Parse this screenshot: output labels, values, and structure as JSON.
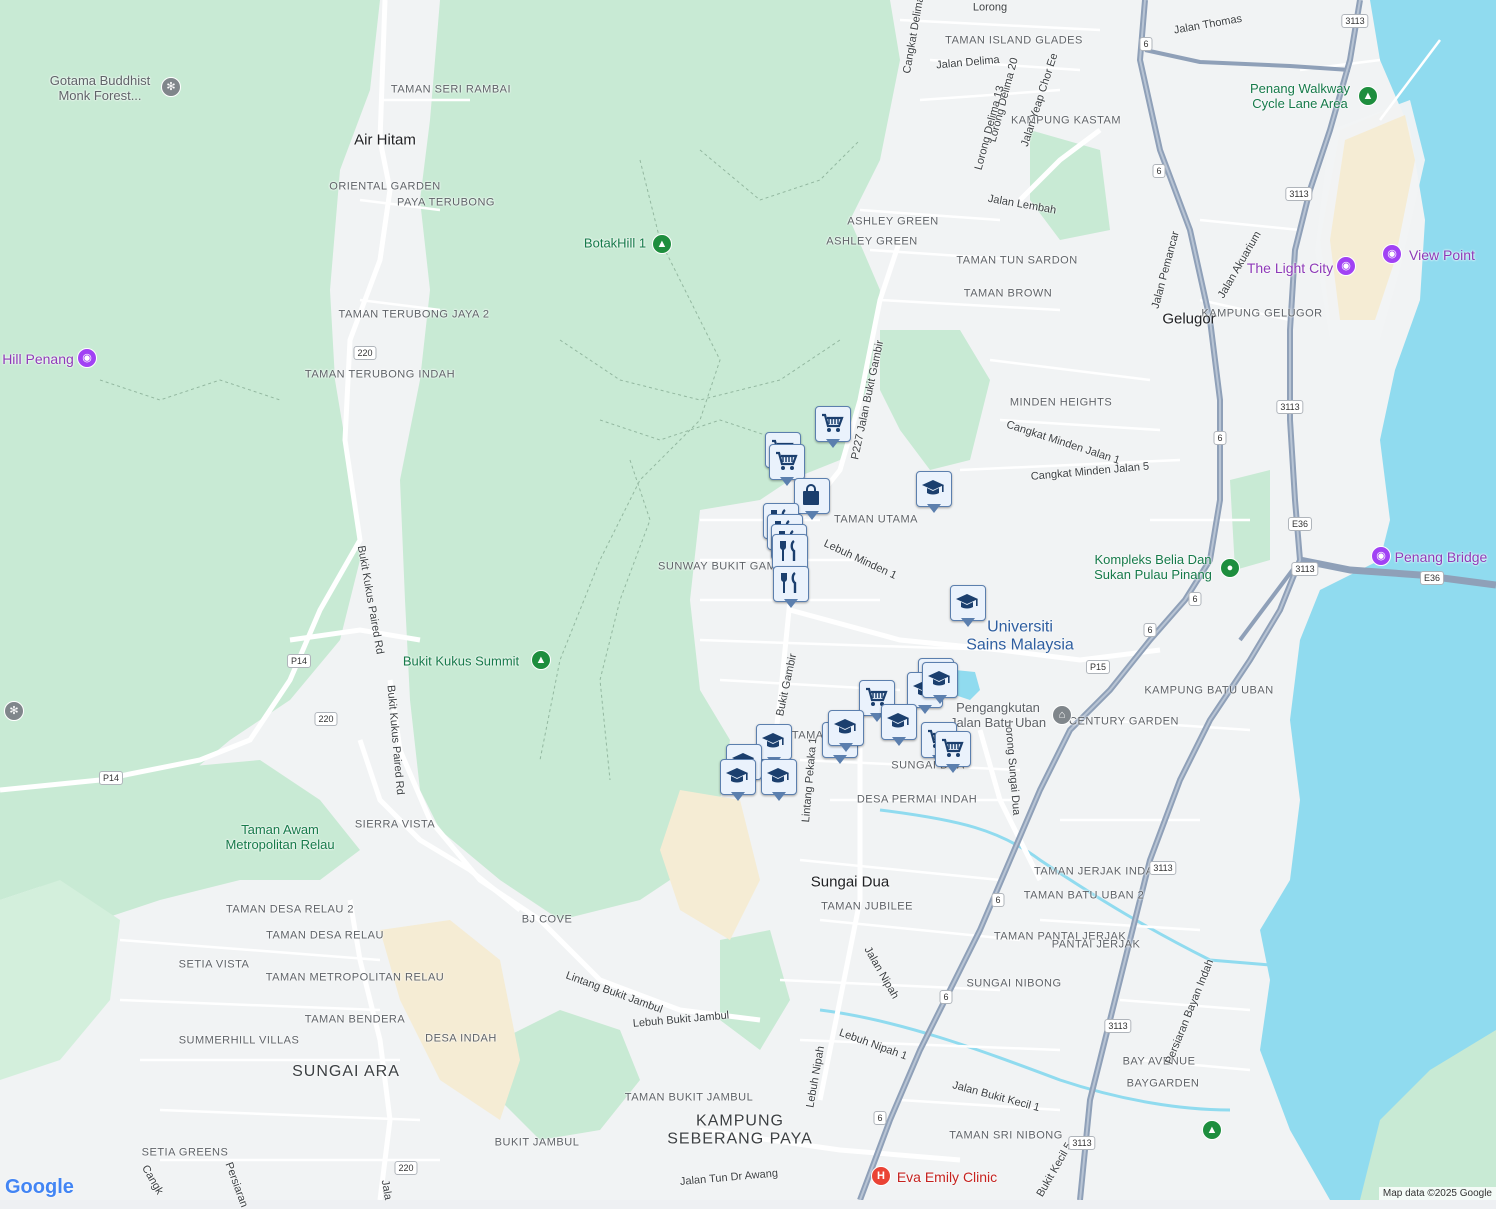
{
  "colors": {
    "forest": "#c8ead4",
    "urban": "#f1f3f4",
    "water": "#90dbef",
    "sand": "#f5ecd4",
    "highway": "#8fa0b8",
    "marker_fill": "#eaf2fc",
    "marker_border": "#5b7fae",
    "marker_icon": "#1b3f6e"
  },
  "labels": {
    "areas": [
      "TAMAN SERI RAMBAI",
      "ORIENTAL GARDEN",
      "PAYA TERUBONG",
      "TAMAN TERUBONG JAYA 2",
      "TAMAN TERUBONG INDAH",
      "SIERRA VISTA",
      "TAMAN DESA RELAU 2",
      "TAMAN DESA RELAU",
      "SETIA VISTA",
      "TAMAN METROPOLITAN RELAU",
      "TAMAN BENDERA",
      "SUMMERHILL VILLAS",
      "DESA INDAH",
      "SETIA GREENS",
      "BJ COVE",
      "TAMAN BUKIT JAMBUL",
      "BUKIT JAMBUL",
      "TAMAN ISLAND GLADES",
      "KAMPUNG KASTAM",
      "ASHLEY GREEN",
      "ASHLEY GREEN",
      "TAMAN TUN SARDON",
      "TAMAN BROWN",
      "KAMPUNG GELUGOR",
      "MINDEN HEIGHTS",
      "TAMAN UTAMA",
      "SUNWAY BUKIT GAMBIER",
      "CENTURY GARDEN",
      "KAMPUNG BATU UBAN",
      "TAMAN",
      "SUNGAI DUA",
      "DESA PERMAI INDAH",
      "TAMAN JUBILEE",
      "TAMAN JERJAK INDAH",
      "TAMAN BATU UBAN 2",
      "TAMAN PANTAI JERJAK",
      "PANTAI JERJAK",
      "SUNGAI NIBONG",
      "BAY AVENUE",
      "BAYGARDEN",
      "TAMAN SRI NIBONG"
    ],
    "places": [
      "Air Hitam",
      "Gelugor",
      "Sungai Dua"
    ],
    "places_large": [
      "SUNGAI ARA",
      "KAMPUNG SEBERANG PAYA"
    ],
    "university": "Universiti Sains Malaysia",
    "roads": [
      "Jalan Thomas",
      "Cangkat Delima",
      "Jalan Delima",
      "Lorong Delima 20",
      "Lorong Delima 13",
      "Jalan Yeap Chor Ee",
      "Jalan Lembah",
      "Jalan Pemancar",
      "Jalan Akuarium",
      "P227 Jalan Bukit Gambir",
      "Cangkat Minden Jalan 1",
      "Cangkat Minden Jalan 5",
      "Lebuh Minden 1",
      "Bukit Gambir",
      "Lintang Pekaka 1",
      "Lorong Sungai Dua",
      "Bukit Kukus Paired Rd",
      "Bukit Kukus Paired Rd",
      "Lintang Bukit Jambul",
      "Lebuh Bukit Jambul",
      "Jalan Nipah",
      "Lebuh Nipah 1",
      "Lebuh Nipah",
      "Jalan Bukit Kecil 1",
      "Jalan Tun Dr Awang",
      "Persiaran Bayan Indah",
      "Bukit Kecil 5",
      "Lorong",
      "Cangk",
      "Persiaran",
      "Jala"
    ],
    "pois": {
      "gotama": "Gotama Buddhist Monk Forest...",
      "botak": "BotakHill 1",
      "hill_penang": "Hill Penang",
      "bukit_kukus": "Bukit Kukus Summit",
      "taman_awam": "Taman Awam Metropolitan Relau",
      "cycle_lane": "Penang Walkway Cycle Lane Area",
      "light_city": "The Light City",
      "view_point": "View Point",
      "penang_bridge": "Penang Bridge",
      "kompleks": "Kompleks Belia Dan Sukan Pulau Pinang",
      "pengangkutan": "Pengangkutan Jalan Batu Uban",
      "eva_emily": "Eva Emily Clinic"
    }
  },
  "shields": [
    "3113",
    "6",
    "6",
    "3113",
    "6",
    "3113",
    "6",
    "E36",
    "3113",
    "E36",
    "6",
    "P15",
    "6",
    "3113",
    "6",
    "6",
    "3113",
    "3113",
    "220",
    "P14",
    "220",
    "P14",
    "220"
  ],
  "markers": [
    {
      "icon": "cart-icon"
    },
    {
      "icon": "cart-icon"
    },
    {
      "icon": "cart-icon"
    },
    {
      "icon": "bag-icon"
    },
    {
      "icon": "school-icon"
    },
    {
      "icon": "restaurant-icon"
    },
    {
      "icon": "restaurant-icon"
    },
    {
      "icon": "restaurant-icon"
    },
    {
      "icon": "restaurant-icon"
    },
    {
      "icon": "restaurant-icon"
    },
    {
      "icon": "school-icon"
    },
    {
      "icon": "school-icon"
    },
    {
      "icon": "school-icon"
    },
    {
      "icon": "cart-icon"
    },
    {
      "icon": "school-icon"
    },
    {
      "icon": "school-icon"
    },
    {
      "icon": "school-icon"
    },
    {
      "icon": "cart-icon"
    },
    {
      "icon": "cart-icon"
    },
    {
      "icon": "school-icon"
    },
    {
      "icon": "school-icon"
    },
    {
      "icon": "school-icon"
    },
    {
      "icon": "school-icon"
    },
    {
      "icon": "school-icon"
    }
  ],
  "attribution": "Map data ©2025 Google",
  "google_logo": "Google"
}
